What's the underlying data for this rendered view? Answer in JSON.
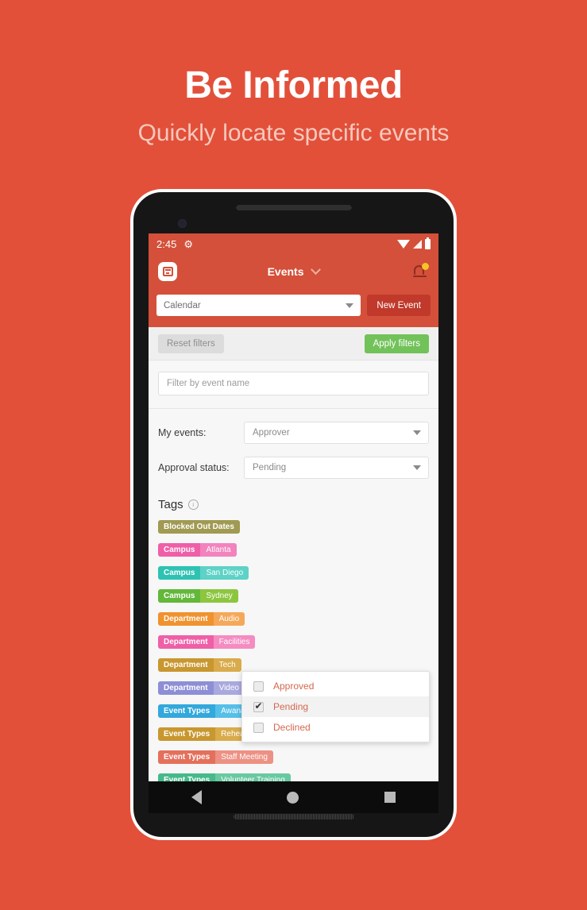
{
  "promo": {
    "title": "Be Informed",
    "subtitle": "Quickly locate specific events"
  },
  "colors": {
    "background": "#e2503a",
    "app_bar": "#d4503a",
    "new_event_button": "#c0392b",
    "apply_button": "#72c25a",
    "reset_button": "#dcdcdc",
    "dropdown_text": "#d4684f"
  },
  "phone": {
    "status_bar": {
      "time": "2:45",
      "gear_icon": "gear-icon",
      "wifi_icon": "wifi-icon",
      "signal_icon": "signal-icon",
      "battery_icon": "battery-icon"
    },
    "app_bar": {
      "left_icon": "calendar-icon",
      "title": "Events",
      "title_caret": "chevron-down-icon",
      "bell_icon": "bell-icon"
    },
    "nav_bar": {
      "back": "back-triangle-icon",
      "home": "home-circle-icon",
      "recents": "recents-square-icon"
    }
  },
  "calendar_row": {
    "select_value": "Calendar",
    "new_event_label": "New Event"
  },
  "filter_actions": {
    "reset_label": "Reset filters",
    "apply_label": "Apply filters"
  },
  "filters": {
    "name_placeholder": "Filter by event name",
    "my_events_label": "My events:",
    "my_events_value": "Approver",
    "approval_status_label": "Approval status:",
    "approval_status_value": "Pending"
  },
  "approval_dropdown": {
    "options": [
      {
        "label": "Approved",
        "checked": false,
        "selected": false
      },
      {
        "label": "Pending",
        "checked": true,
        "selected": true
      },
      {
        "label": "Declined",
        "checked": false,
        "selected": false
      }
    ]
  },
  "tags_section": {
    "title": "Tags",
    "info_icon": "info-icon",
    "tags": [
      {
        "key": "Blocked Out Dates",
        "value": "",
        "key_color": "#a09a52",
        "value_color": "#a09a52"
      },
      {
        "key": "Campus",
        "value": "Atlanta",
        "key_color": "#ef5fa8",
        "value_color": "#f283bd"
      },
      {
        "key": "Campus",
        "value": "San Diego",
        "key_color": "#2ec2b3",
        "value_color": "#5ed2c6"
      },
      {
        "key": "Campus",
        "value": "Sydney",
        "key_color": "#63b83a",
        "value_color": "#8cc63f"
      },
      {
        "key": "Department",
        "value": "Audio",
        "key_color": "#f0922e",
        "value_color": "#f5a85a"
      },
      {
        "key": "Department",
        "value": "Facilities",
        "key_color": "#ef5fa8",
        "value_color": "#f48cc2"
      },
      {
        "key": "Department",
        "value": "Tech",
        "key_color": "#c9972f",
        "value_color": "#d9ab4c"
      },
      {
        "key": "Department",
        "value": "Video",
        "key_color": "#8e8ed6",
        "value_color": "#a9a9e0"
      },
      {
        "key": "Event Types",
        "value": "Awana",
        "key_color": "#32a8dd",
        "value_color": "#56bfe8"
      },
      {
        "key": "Event Types",
        "value": "Rehearsal",
        "key_color": "#c9972f",
        "value_color": "#d9ab4c"
      },
      {
        "key": "Event Types",
        "value": "Staff Meeting",
        "key_color": "#e4705c",
        "value_color": "#ec9184"
      },
      {
        "key": "Event Types",
        "value": "Volunteer Training",
        "key_color": "#45b98a",
        "value_color": "#68c9a1"
      }
    ]
  }
}
